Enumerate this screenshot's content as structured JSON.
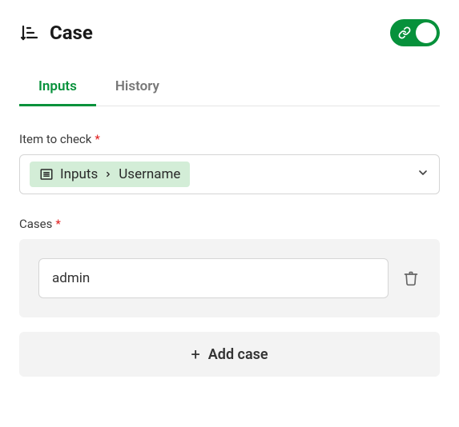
{
  "header": {
    "title": "Case"
  },
  "toggle": {
    "enabled": true
  },
  "tabs": {
    "inputs": "Inputs",
    "history": "History",
    "active": "inputs"
  },
  "fields": {
    "item_to_check": {
      "label": "Item to check",
      "required": true,
      "value": {
        "source": "Inputs",
        "field": "Username"
      }
    },
    "cases": {
      "label": "Cases",
      "required": true,
      "items": [
        {
          "value": "admin"
        }
      ]
    }
  },
  "buttons": {
    "add_case": "Add case"
  }
}
